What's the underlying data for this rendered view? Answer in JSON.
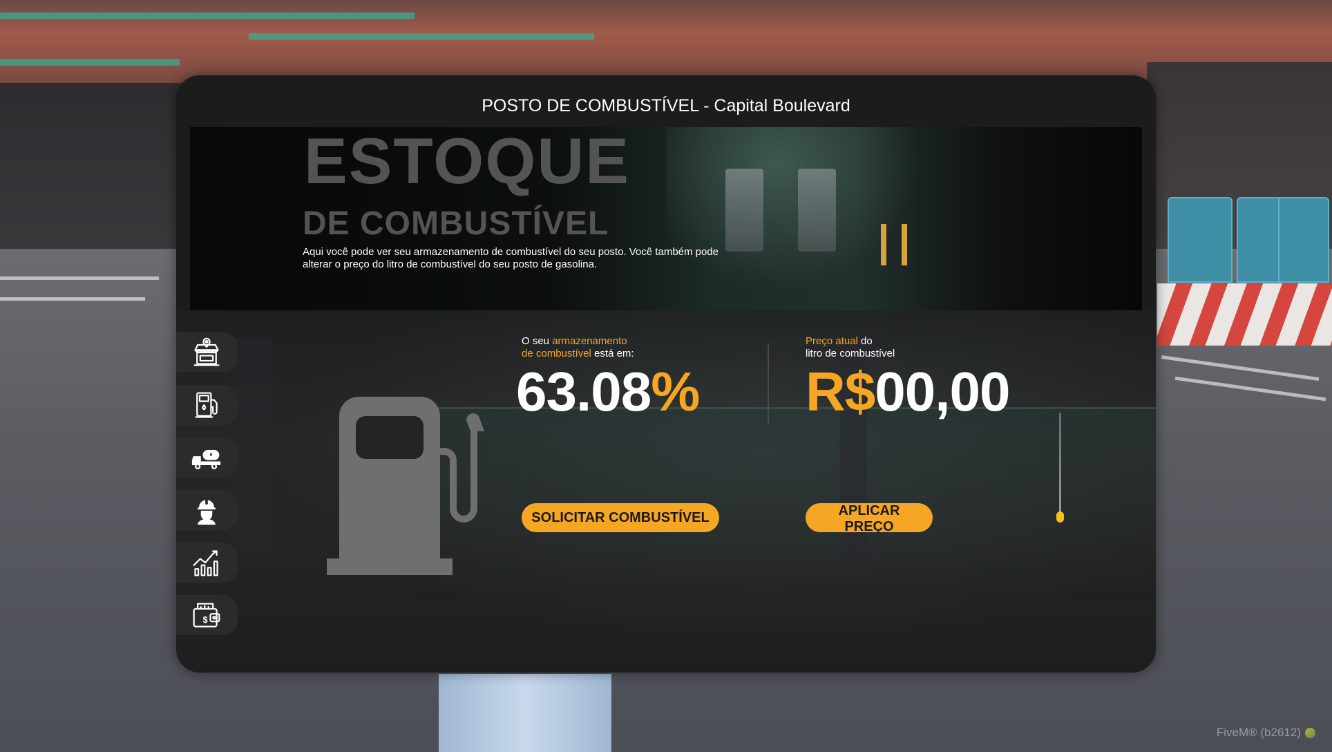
{
  "window": {
    "title": "POSTO DE COMBUSTÍVEL - Capital Boulevard"
  },
  "banner": {
    "heading": "ESTOQUE",
    "subheading": "DE COMBUSTÍVEL",
    "description": "Aqui você pode ver seu armazenamento de combustível do seu posto. Você também pode alterar o preço do litro de combustível do seu posto de gasolina."
  },
  "sidebar": {
    "items": [
      {
        "icon": "store-location-icon"
      },
      {
        "icon": "fuel-pump-icon"
      },
      {
        "icon": "tanker-truck-icon"
      },
      {
        "icon": "worker-helmet-icon"
      },
      {
        "icon": "chart-growth-icon"
      },
      {
        "icon": "wallet-money-icon"
      }
    ]
  },
  "storage": {
    "label_prefix": "O seu ",
    "label_highlight_1": "armazenamento",
    "label_highlight_2": "de combustível",
    "label_suffix": " está em:",
    "value": "63.08",
    "unit": "%",
    "button": "SOLICITAR COMBUSTÍVEL"
  },
  "price": {
    "label_highlight": "Preço atual",
    "label_line1_suffix": " do",
    "label_line2": "litro de combustível",
    "currency": "R$",
    "value": "00,00",
    "button": "APLICAR PREÇO",
    "slider_level": 0.05
  },
  "footer": {
    "watermark": "FiveM® (b2612)"
  },
  "colors": {
    "accent": "#f5a623",
    "panel": "#1c1c1c",
    "sidebar_button": "#2b2b2b"
  }
}
